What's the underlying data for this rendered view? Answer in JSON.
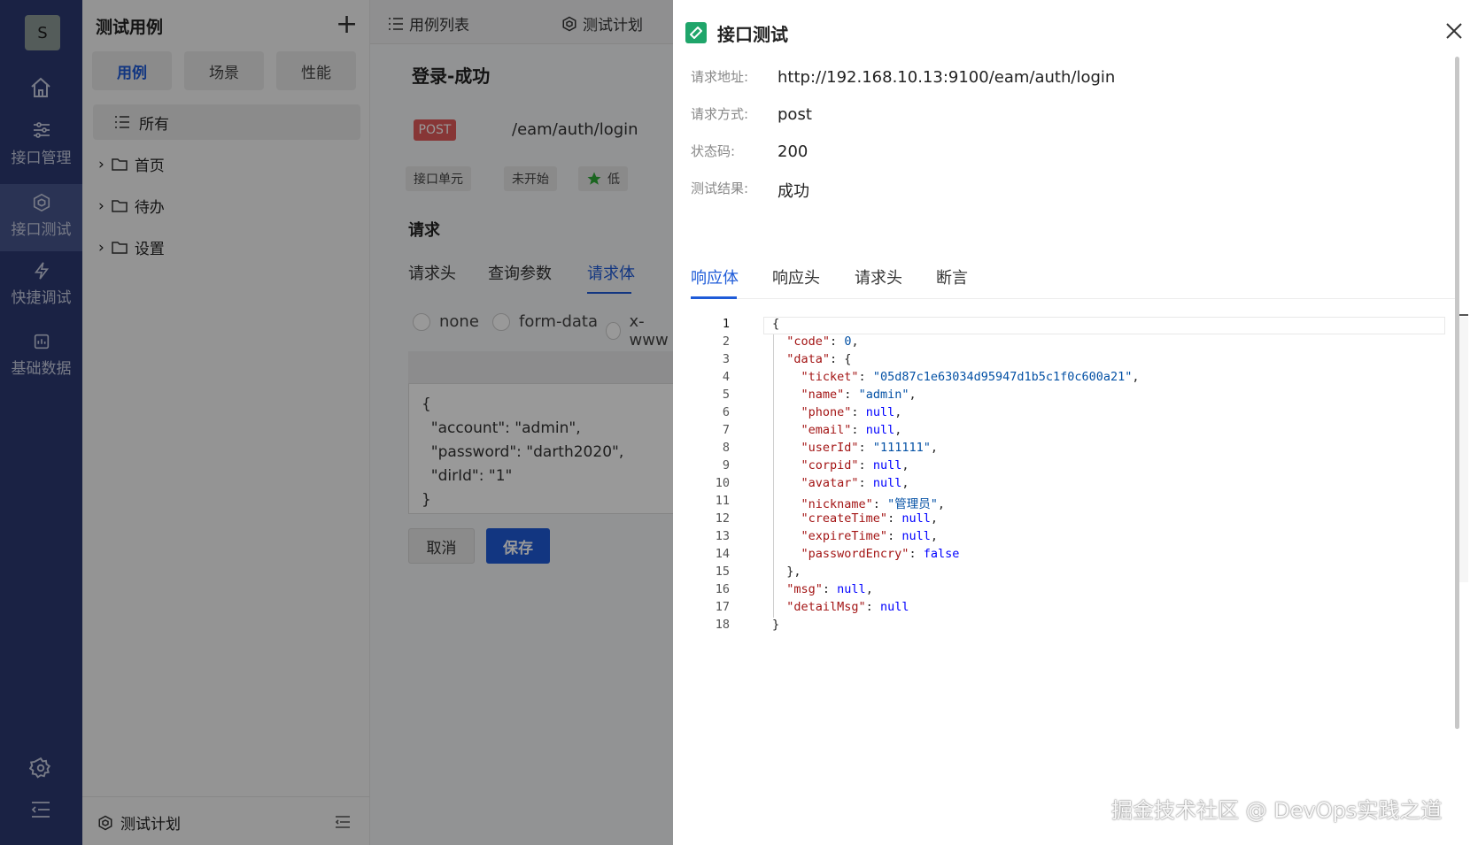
{
  "rail": {
    "logo": "S",
    "items": [
      {
        "label": "接口管理"
      },
      {
        "label": "接口测试"
      },
      {
        "label": "快捷调试"
      },
      {
        "label": "基础数据"
      }
    ]
  },
  "tree": {
    "title": "测试用例",
    "add": "+",
    "segments": [
      "用例",
      "场景",
      "性能"
    ],
    "all": "所有",
    "nodes": [
      "首页",
      "待办",
      "设置"
    ],
    "footer": "测试计划"
  },
  "editor": {
    "topnav": [
      "用例列表",
      "测试计划"
    ],
    "case_title": "登录-成功",
    "method": "POST",
    "path": "/eam/auth/login",
    "tags": [
      "接口单元",
      "未开始",
      "低"
    ],
    "section": "请求",
    "subtabs": [
      "请求头",
      "查询参数",
      "请求体"
    ],
    "radios": [
      "none",
      "form-data",
      "x-www"
    ],
    "body": "{\n  \"account\": \"admin\",\n  \"password\": \"darth2020\",\n  \"dirId\": \"1\"\n}",
    "cancel": "取消",
    "save": "保存"
  },
  "drawer": {
    "title": "接口测试",
    "fields": [
      {
        "label": "请求地址:",
        "value": "http://192.168.10.13:9100/eam/auth/login"
      },
      {
        "label": "请求方式:",
        "value": "post"
      },
      {
        "label": "状态码:",
        "value": "200"
      },
      {
        "label": "测试结果:",
        "value": "成功"
      }
    ],
    "tabs": [
      "响应体",
      "响应头",
      "请求头",
      "断言"
    ],
    "line_numbers": [
      "1",
      "2",
      "3",
      "4",
      "5",
      "6",
      "7",
      "8",
      "9",
      "10",
      "11",
      "12",
      "13",
      "14",
      "15",
      "16",
      "17",
      "18"
    ]
  },
  "watermark": "掘金技术社区 @ DevOps实践之道"
}
